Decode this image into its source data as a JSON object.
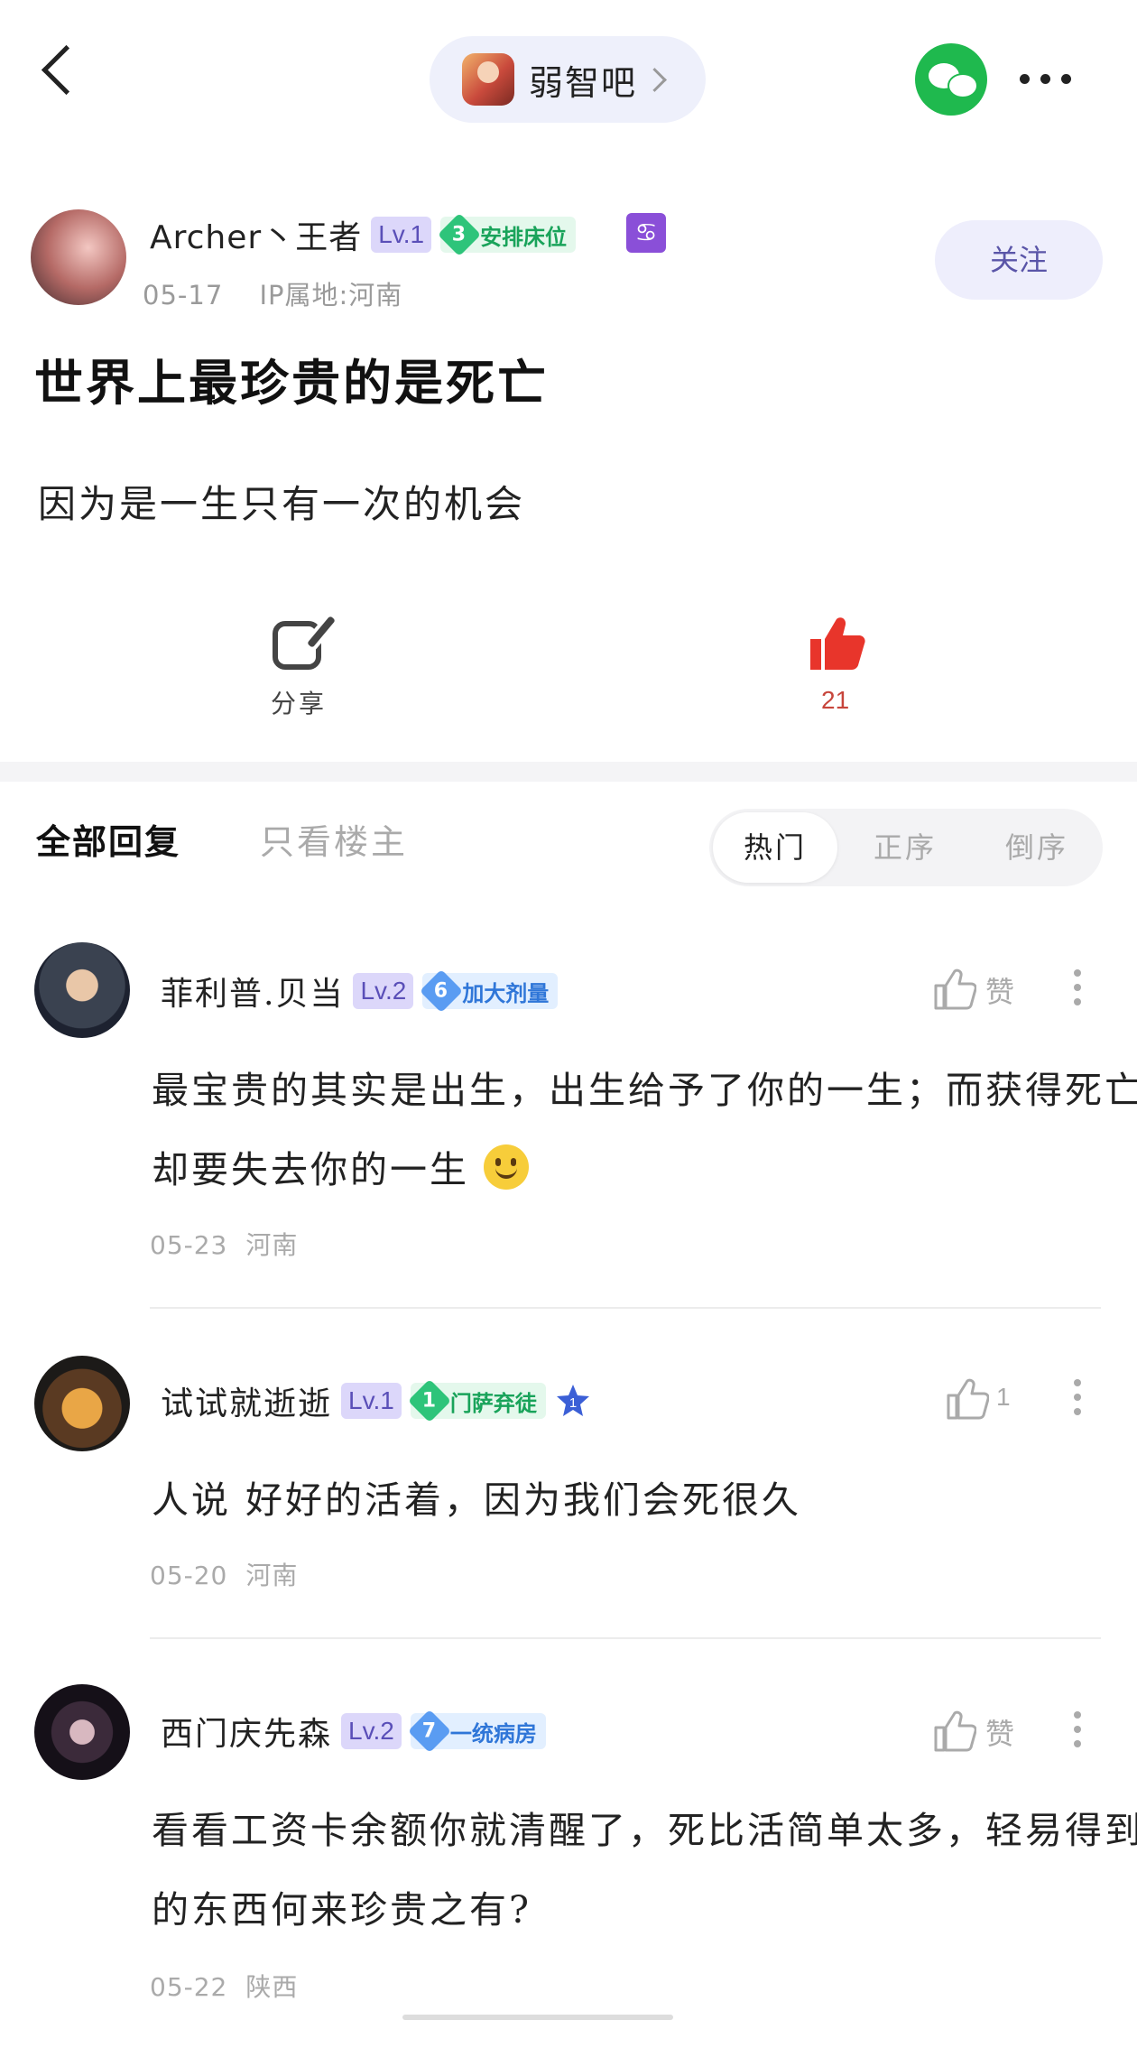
{
  "header": {
    "forum_name": "弱智吧",
    "icons": [
      "back-icon",
      "forum-avatar",
      "chevron-right-icon",
      "wechat-icon",
      "more-icon"
    ]
  },
  "post": {
    "author": {
      "name": "Archer丶王者",
      "level": "Lv.1",
      "badge_num": "3",
      "badge_text": "安排床位",
      "zodiac": "♋",
      "date": "05-17",
      "ip": "IP属地:河南"
    },
    "follow_label": "关注",
    "title": "世界上最珍贵的是死亡",
    "content": "因为是一生只有一次的机会",
    "share_label": "分享",
    "like_count": "21"
  },
  "tabs": {
    "all": "全部回复",
    "op_only": "只看楼主",
    "sort": [
      "热门",
      "正序",
      "倒序"
    ],
    "active_sort": "热门"
  },
  "comments": [
    {
      "name": "菲利普.贝当",
      "level": "Lv.2",
      "badge_num": "6",
      "badge_text": "加大剂量",
      "text": "最宝贵的其实是出生，出生给予了你的一生；而获得死亡却要失去你的一生",
      "date": "05-23",
      "location": "河南",
      "like": "赞"
    },
    {
      "name": "试试就逝逝",
      "level": "Lv.1",
      "badge_num": "1",
      "badge_text": "门萨弃徒",
      "rank_num": "1",
      "text": "人说 好好的活着，因为我们会死很久",
      "date": "05-20",
      "location": "河南",
      "like": "1"
    },
    {
      "name": "西门庆先森",
      "level": "Lv.2",
      "badge_num": "7",
      "badge_text": "一统病房",
      "text": "看看工资卡余额你就清醒了，死比活简单太多，轻易得到的东西何来珍贵之有?",
      "date": "05-22",
      "location": "陕西",
      "like": "赞"
    }
  ],
  "colors": {
    "accent_purple": "#5a4fb8",
    "like_red": "#e8352b",
    "wechat_green": "#1fb94e"
  }
}
